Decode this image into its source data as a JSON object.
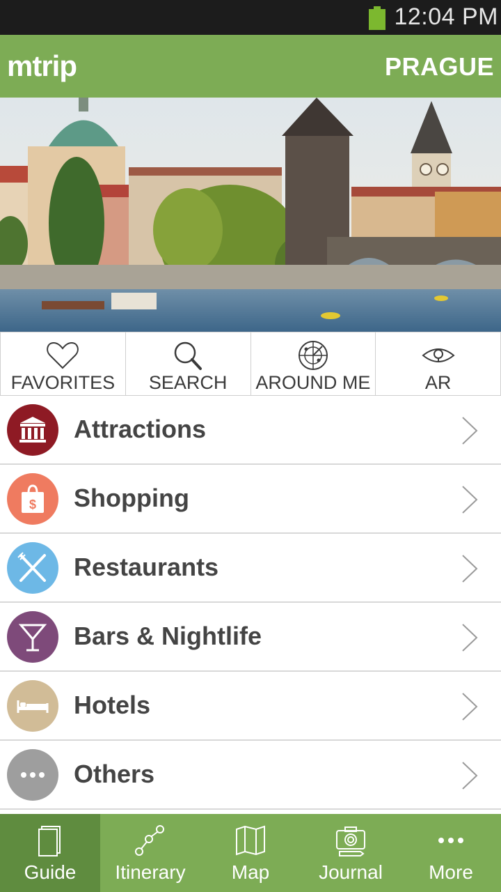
{
  "status_bar": {
    "time": "12:04 PM",
    "battery_icon": "battery-full-icon"
  },
  "header": {
    "logo": "mtrip",
    "city": "PRAGUE"
  },
  "hero": {
    "alt": "Prague panorama"
  },
  "quick_actions": [
    {
      "label": "FAVORITES",
      "icon": "heart-icon"
    },
    {
      "label": "SEARCH",
      "icon": "search-icon"
    },
    {
      "label": "AROUND ME",
      "icon": "radar-icon"
    },
    {
      "label": "AR",
      "icon": "eye-icon"
    }
  ],
  "categories": [
    {
      "label": "Attractions",
      "icon": "museum-icon",
      "color": "#8e1a24"
    },
    {
      "label": "Shopping",
      "icon": "shopping-bag-icon",
      "color": "#ef7b60"
    },
    {
      "label": "Restaurants",
      "icon": "cutlery-icon",
      "color": "#6db8e6"
    },
    {
      "label": "Bars & Nightlife",
      "icon": "cocktail-icon",
      "color": "#7e4a7a"
    },
    {
      "label": "Hotels",
      "icon": "bed-icon",
      "color": "#d1bc97"
    },
    {
      "label": "Others",
      "icon": "more-dots-icon",
      "color": "#9e9e9e"
    }
  ],
  "bottom_nav": [
    {
      "label": "Guide",
      "icon": "guide-book-icon",
      "active": true
    },
    {
      "label": "Itinerary",
      "icon": "itinerary-path-icon",
      "active": false
    },
    {
      "label": "Map",
      "icon": "map-icon",
      "active": false
    },
    {
      "label": "Journal",
      "icon": "camera-journal-icon",
      "active": false
    },
    {
      "label": "More",
      "icon": "more-dots-icon",
      "active": false
    }
  ],
  "colors": {
    "brand_green": "#7dac55",
    "active_green": "#5f8c3f",
    "status_bar": "#1c1c1c",
    "battery": "#7cb82f"
  }
}
